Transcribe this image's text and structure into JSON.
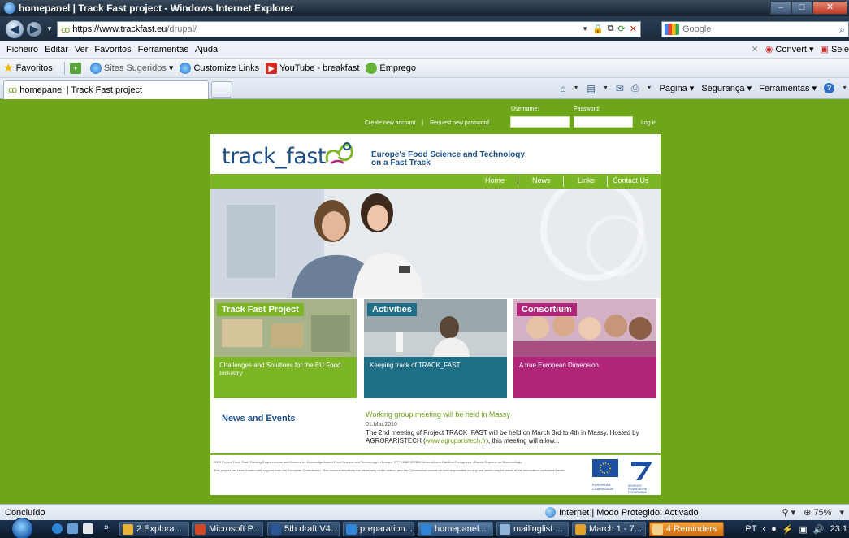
{
  "window": {
    "title": "homepanel | Track Fast project - Windows Internet Explorer"
  },
  "address": {
    "url_main": "https://www.trackfast.eu",
    "url_path": "/drupal/"
  },
  "search": {
    "placeholder": "Google"
  },
  "menu": {
    "items": [
      "Ficheiro",
      "Editar",
      "Ver",
      "Favoritos",
      "Ferramentas",
      "Ajuda"
    ],
    "convert_label": "Convert",
    "select_label": "Sele"
  },
  "favorites": {
    "label": "Favoritos",
    "items": [
      "Sites Sugeridos",
      "Customize Links",
      "YouTube - breakfast",
      "Emprego"
    ]
  },
  "tabs": {
    "active_title": "homepanel | Track Fast project"
  },
  "command_bar": {
    "page_label": "Página",
    "security_label": "Segurança",
    "tools_label": "Ferramentas"
  },
  "page": {
    "login": {
      "create_account": "Create new account",
      "separator": "|",
      "request_password": "Request new password",
      "username_label": "Username:",
      "password_label": "Password:",
      "login_button": "Log in"
    },
    "logo_text": "track_fast",
    "tagline_line1": "Europe's Food Science and Technology",
    "tagline_line2": "on a Fast Track",
    "nav": [
      "Home",
      "News",
      "Links",
      "Contact Us"
    ],
    "cards": [
      {
        "title": "Track Fast Project",
        "description": "Challenges and Solutions for the EU Food Industry"
      },
      {
        "title": "Activities",
        "description": "Keeping track of TRACK_FAST"
      },
      {
        "title": "Consortium",
        "description": "A true European Dimension"
      }
    ],
    "news": {
      "heading": "News and Events",
      "title": "Working group meeting will be held in Massy",
      "date": "01.Mar.2010",
      "body_start": "The 2nd meeting of Project TRACK_FAST will be held on March 3rd to 4th in Massy. Hosted by AGROPARISTECH (",
      "body_link": "www.agroparistech.fr",
      "body_end": "), this meeting will allow..."
    },
    "footer": {
      "line1": "2009 Project Track Fast: Training Requirements and Careers for Knowledge-based Food Science and Technology in Europe. FP7 KBBE 227220 Universidade Católica Portuguesa - Escola Superior de Biotecnologia",
      "line2": "This project has been funded with support from the European Commission. This document reflects the views only of the author, and the Commission cannot be held responsible for any use which may be made of the information contained therein.",
      "eu_label": "EUROPEAN COMMISSION",
      "fp7_label": "SEVENTH FRAMEWORK PROGRAMME"
    }
  },
  "status": {
    "left": "Concluído",
    "zone": "Internet | Modo Protegido: Activado",
    "zoom": "75%"
  },
  "taskbar": {
    "buttons": [
      "2 Explora...",
      "Microsoft P...",
      "5th draft V4...",
      "preparation...",
      "homepanel...",
      "mailinglist ...",
      "March 1 - 7...",
      "4 Reminders"
    ],
    "lang": "PT",
    "clock": "23:1"
  },
  "colors": {
    "page_green": "#6fa51b",
    "nav_green": "#7cb626",
    "teal": "#1e6f86",
    "magenta": "#b0247a",
    "brand_blue": "#1c4f88"
  }
}
